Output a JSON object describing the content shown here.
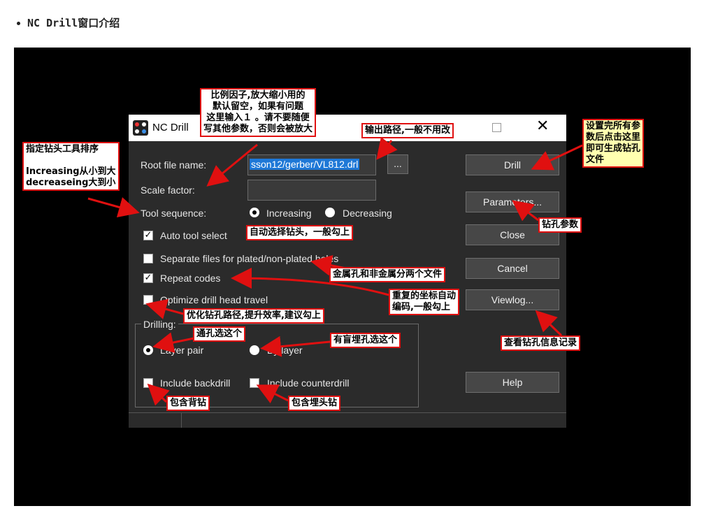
{
  "article": {
    "heading": "NC Drill窗口介绍"
  },
  "colors": {
    "annotation_border": "#e01010",
    "dialog_bg": "#2b2b2b",
    "stage_bg": "#000000",
    "highlight_bg": "#ffffb0",
    "selection": "#1e78d7"
  },
  "dialog": {
    "title": "NC Drill",
    "root_file_label": "Root file name:",
    "root_file_value": "sson12/gerber/VL812.drl",
    "browse_label": "...",
    "scale_factor_label": "Scale factor:",
    "scale_factor_value": "",
    "tool_sequence_label": "Tool sequence:",
    "increasing_label": "Increasing",
    "decreasing_label": "Decreasing",
    "auto_tool_select_label": "Auto tool select",
    "separate_files_label": "Separate files for plated/non-plated holes",
    "repeat_codes_label": "Repeat codes",
    "optimize_label": "Optimize drill head travel",
    "drilling_group_label": "Drilling:",
    "layer_pair_label": "Layer pair",
    "by_layer_label": "By layer",
    "include_backdrill_label": "Include backdrill",
    "include_counterdrill_label": "Include counterdrill",
    "buttons": {
      "drill": "Drill",
      "parameters": "Parameters...",
      "close": "Close",
      "cancel": "Cancel",
      "viewlog": "Viewlog...",
      "help": "Help"
    },
    "state": {
      "tool_sequence": "Increasing",
      "auto_tool_select": true,
      "separate_files": false,
      "repeat_codes": true,
      "optimize": false,
      "drilling": "Layer pair",
      "include_backdrill": false,
      "include_counterdrill": false
    }
  },
  "annotations": {
    "scale_note": "比例因子,放大缩小用的\n默认留空，如果有问题\n这里输入１ 。请不要随便\n写其他参数，否则会被放大",
    "output_path_note": "输出路径,一般不用改",
    "drill_note": "设置完所有参\n数后点击这里\n即可生成钻孔\n文件",
    "tool_sort_note": "指定钻头工具排序\n\nIncreasing从小到大\ndecreaseing大到小",
    "auto_select_note": "自动选择钻头，一般勾上",
    "params_note": "钻孔参数",
    "plated_note": "金属孔和非金属分两个文件",
    "repeat_note": "重复的坐标自动\n编码,一般勾上",
    "optimize_note": "优化钻孔路径,提升效率,建议勾上",
    "viewlog_note": "查看钻孔信息记录",
    "through_note": "通孔选这个",
    "blind_note": "有盲埋孔选这个",
    "backdrill_note": "包含背钻",
    "counterdrill_note": "包含埋头钻"
  }
}
